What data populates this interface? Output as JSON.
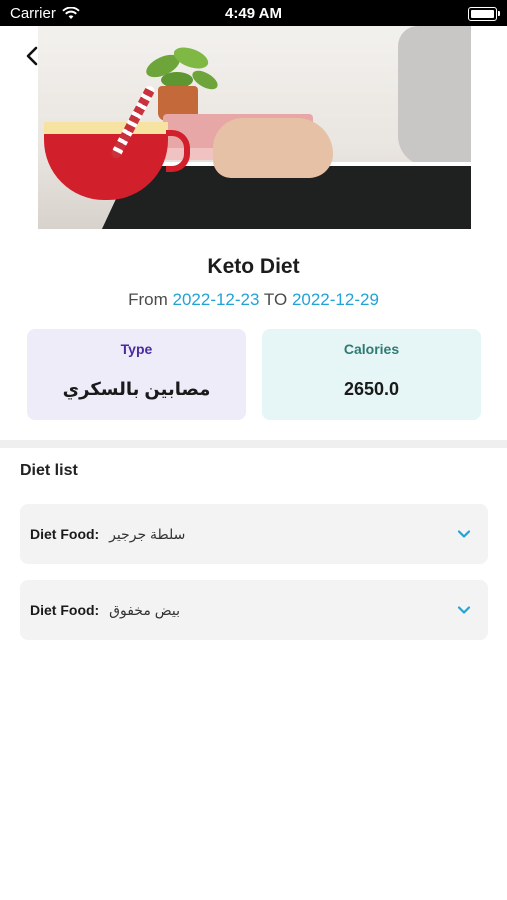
{
  "status_bar": {
    "carrier": "Carrier",
    "time": "4:49 AM"
  },
  "header": {
    "back_icon": "chevron-left-icon"
  },
  "diet": {
    "name": "Keto Diet",
    "from_label": "From",
    "from_date": "2022-12-23",
    "to_label": "TO",
    "to_date": "2022-12-29"
  },
  "cards": {
    "type": {
      "label": "Type",
      "value": "مصابين بالسكري"
    },
    "calories": {
      "label": "Calories",
      "value": "2650.0"
    }
  },
  "diet_list": {
    "title": "Diet list",
    "items": [
      {
        "key": "Diet Food:",
        "value": "سلطة جرجير"
      },
      {
        "key": "Diet Food:",
        "value": "بيض مخفوق"
      }
    ]
  },
  "colors": {
    "accent": "#22a3d6",
    "type_card_bg": "#eeecf9",
    "calories_card_bg": "#e6f5f5"
  }
}
